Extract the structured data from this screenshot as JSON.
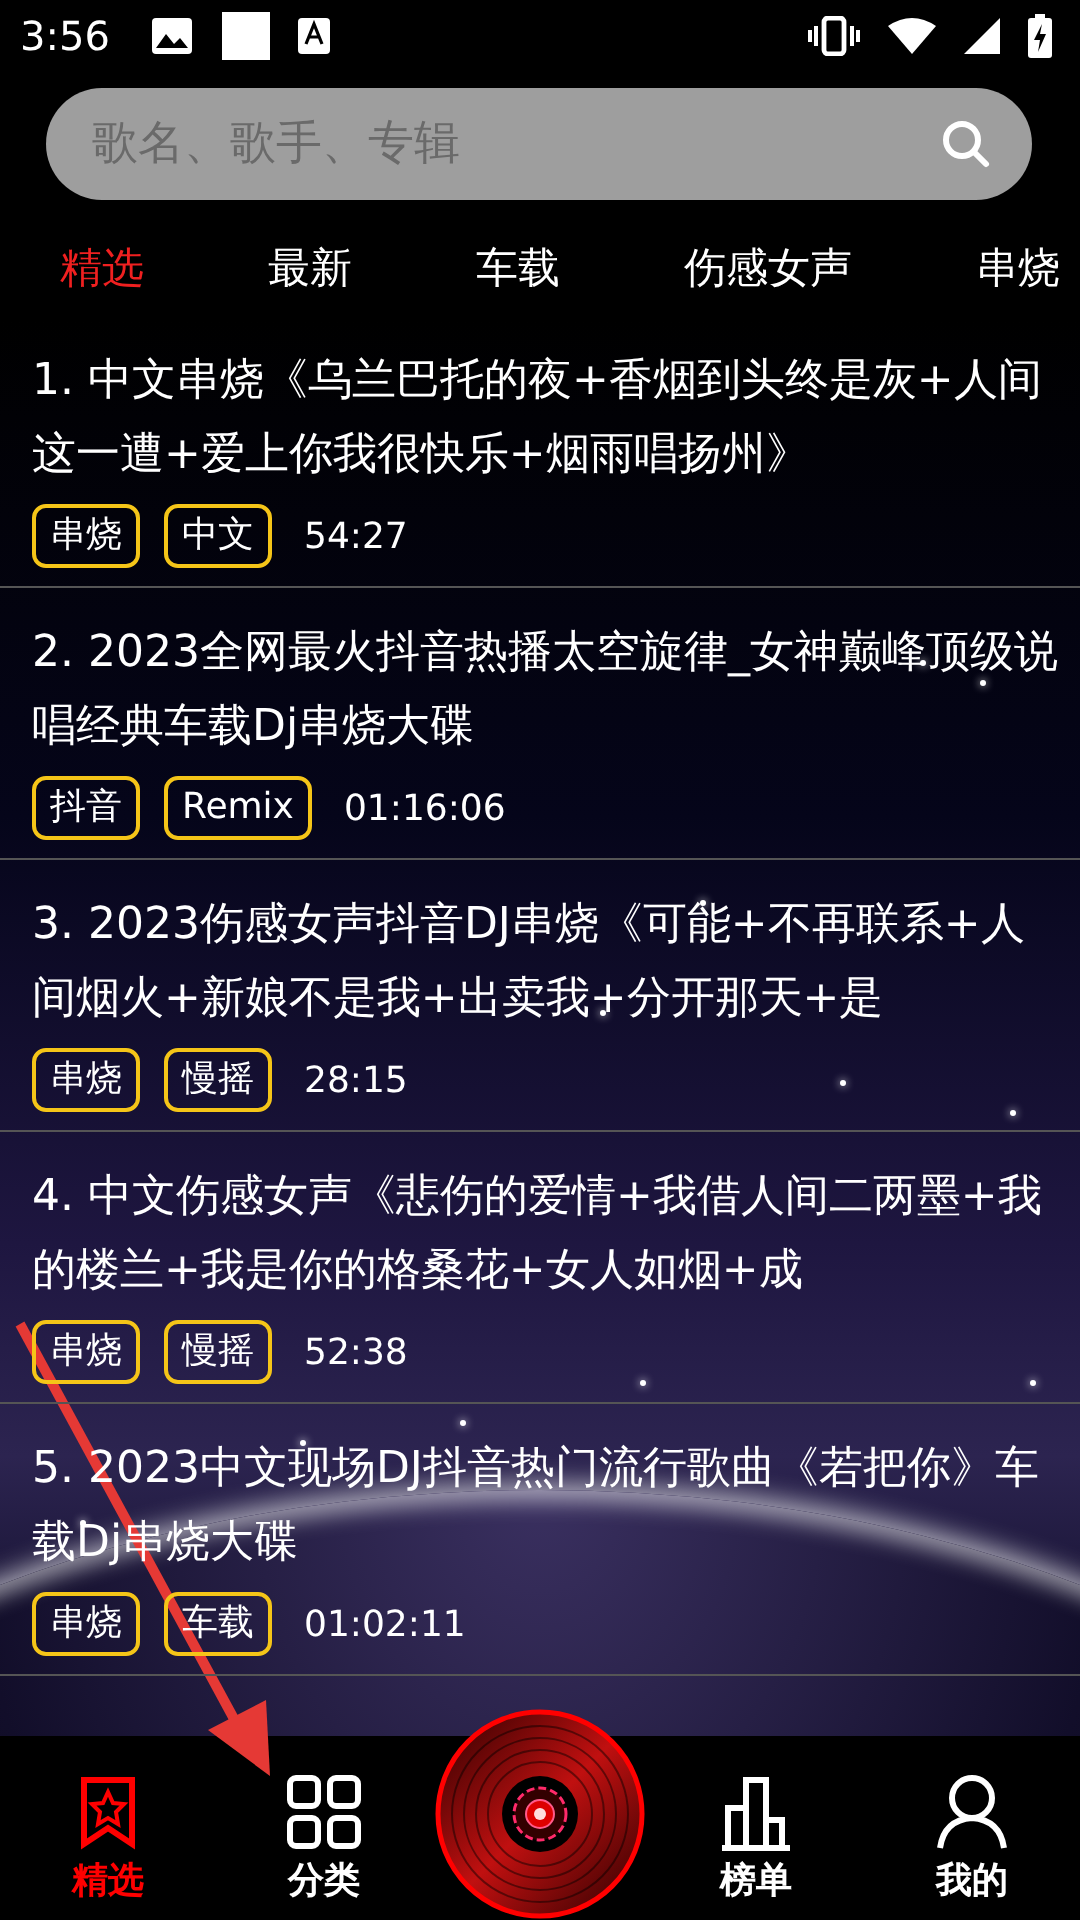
{
  "status_bar": {
    "time": "3:56"
  },
  "search": {
    "placeholder": "歌名、歌手、专辑"
  },
  "tabs": [
    {
      "label": "精选",
      "selected": true
    },
    {
      "label": "最新",
      "selected": false
    },
    {
      "label": "车载",
      "selected": false
    },
    {
      "label": "伤感女声",
      "selected": false
    },
    {
      "label": "串烧",
      "selected": false
    }
  ],
  "songs": [
    {
      "title": "1. 中文串烧《乌兰巴托的夜+香烟到头终是灰+人间这一遭+爱上你我很快乐+烟雨唱扬州》",
      "tags": [
        "串烧",
        "中文"
      ],
      "duration": "54:27"
    },
    {
      "title": "2. 2023全网最火抖音热播太空旋律_女神巅峰顶级说唱经典车载Dj串烧大碟",
      "tags": [
        "抖音",
        "Remix"
      ],
      "duration": "01:16:06"
    },
    {
      "title": "3. 2023伤感女声抖音DJ串烧《可能+不再联系+人间烟火+新娘不是我+出卖我+分开那天+是",
      "tags": [
        "串烧",
        "慢摇"
      ],
      "duration": "28:15"
    },
    {
      "title": "4. 中文伤感女声《悲伤的爱情+我借人间二两墨+我的楼兰+我是你的格桑花+女人如烟+成",
      "tags": [
        "串烧",
        "慢摇"
      ],
      "duration": "52:38"
    },
    {
      "title": "5. 2023中文现场DJ抖音热门流行歌曲《若把你》车载Dj串烧大碟",
      "tags": [
        "串烧",
        "车载"
      ],
      "duration": "01:02:11"
    }
  ],
  "bottom_nav": [
    {
      "kind": "featured",
      "label": "精选",
      "selected": true
    },
    {
      "kind": "category",
      "label": "分类",
      "selected": false
    },
    {
      "kind": "player",
      "selected": false
    },
    {
      "kind": "chart",
      "label": "榜单",
      "selected": false
    },
    {
      "kind": "profile",
      "label": "我的",
      "selected": false
    }
  ]
}
